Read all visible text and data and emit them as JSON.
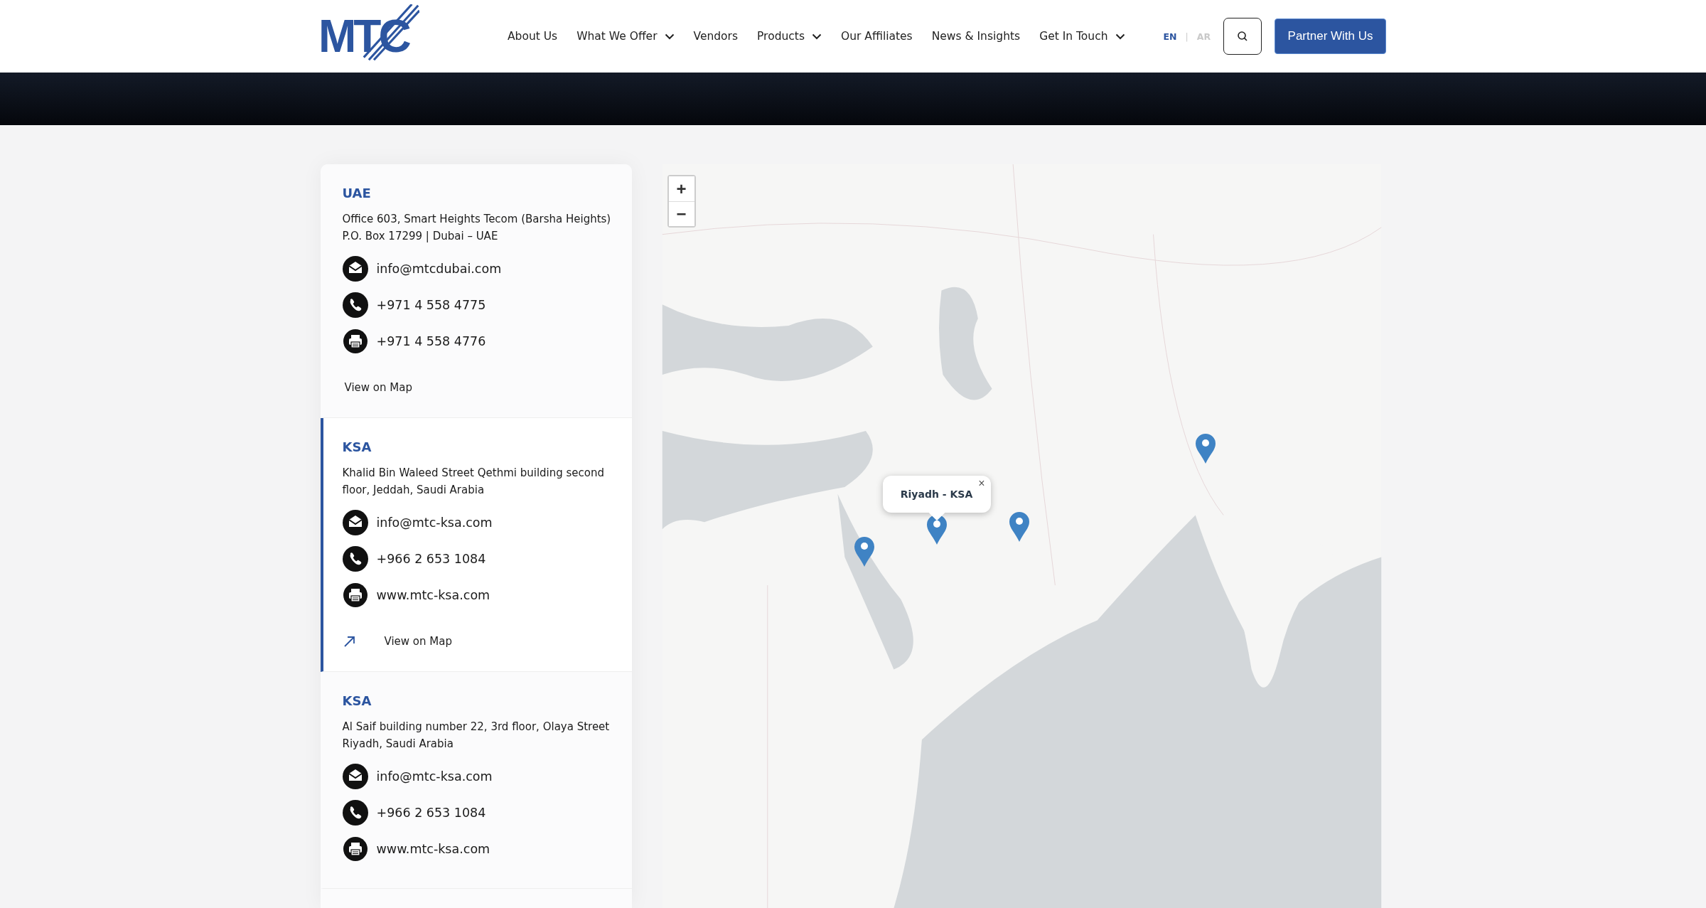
{
  "header": {
    "logo": "MTC",
    "nav": [
      {
        "label": "About Us",
        "dropdown": false
      },
      {
        "label": "What We Offer",
        "dropdown": true
      },
      {
        "label": "Vendors",
        "dropdown": false
      },
      {
        "label": "Products",
        "dropdown": true
      },
      {
        "label": "Our Affiliates",
        "dropdown": false
      },
      {
        "label": "News & Insights",
        "dropdown": false
      },
      {
        "label": "Get In Touch",
        "dropdown": true
      }
    ],
    "languages": [
      {
        "label": "EN",
        "selected": true
      },
      {
        "label": "AR",
        "selected": false
      }
    ],
    "separator": "|",
    "cta": "Partner With Us"
  },
  "offices": [
    {
      "country": "UAE",
      "address": "Office 603, Smart Heights Tecom (Barsha Heights) P.O. Box 17299 | Dubai – UAE",
      "selected": false,
      "contacts": [
        {
          "kind": "email",
          "text": "info@mtcdubai.com"
        },
        {
          "kind": "phone",
          "text": "+971 4 558 4775"
        },
        {
          "kind": "fax",
          "text": "+971 4 558 4776"
        }
      ],
      "view_on_map": "View on Map"
    },
    {
      "country": "KSA",
      "address": "Khalid Bin Waleed Street Qethmi building second floor, Jeddah, Saudi Arabia",
      "selected": true,
      "contacts": [
        {
          "kind": "email",
          "text": "info@mtc-ksa.com"
        },
        {
          "kind": "phone",
          "text": "+966 2 653 1084"
        },
        {
          "kind": "fax",
          "text": "www.mtc-ksa.com"
        }
      ],
      "view_on_map": "View on Map"
    },
    {
      "country": "KSA",
      "address": "Al Saif building number 22, 3rd floor, Olaya Street Riyadh, Saudi Arabia",
      "selected": false,
      "contacts": [
        {
          "kind": "email",
          "text": "info@mtc-ksa.com"
        },
        {
          "kind": "phone",
          "text": "+966 2 653 1084"
        },
        {
          "kind": "fax",
          "text": "www.mtc-ksa.com"
        }
      ]
    }
  ],
  "map": {
    "kind": "picture",
    "zoom_in": "+",
    "zoom_out": "−",
    "popup": {
      "title": "Riyadh - KSA",
      "close": "×"
    }
  }
}
